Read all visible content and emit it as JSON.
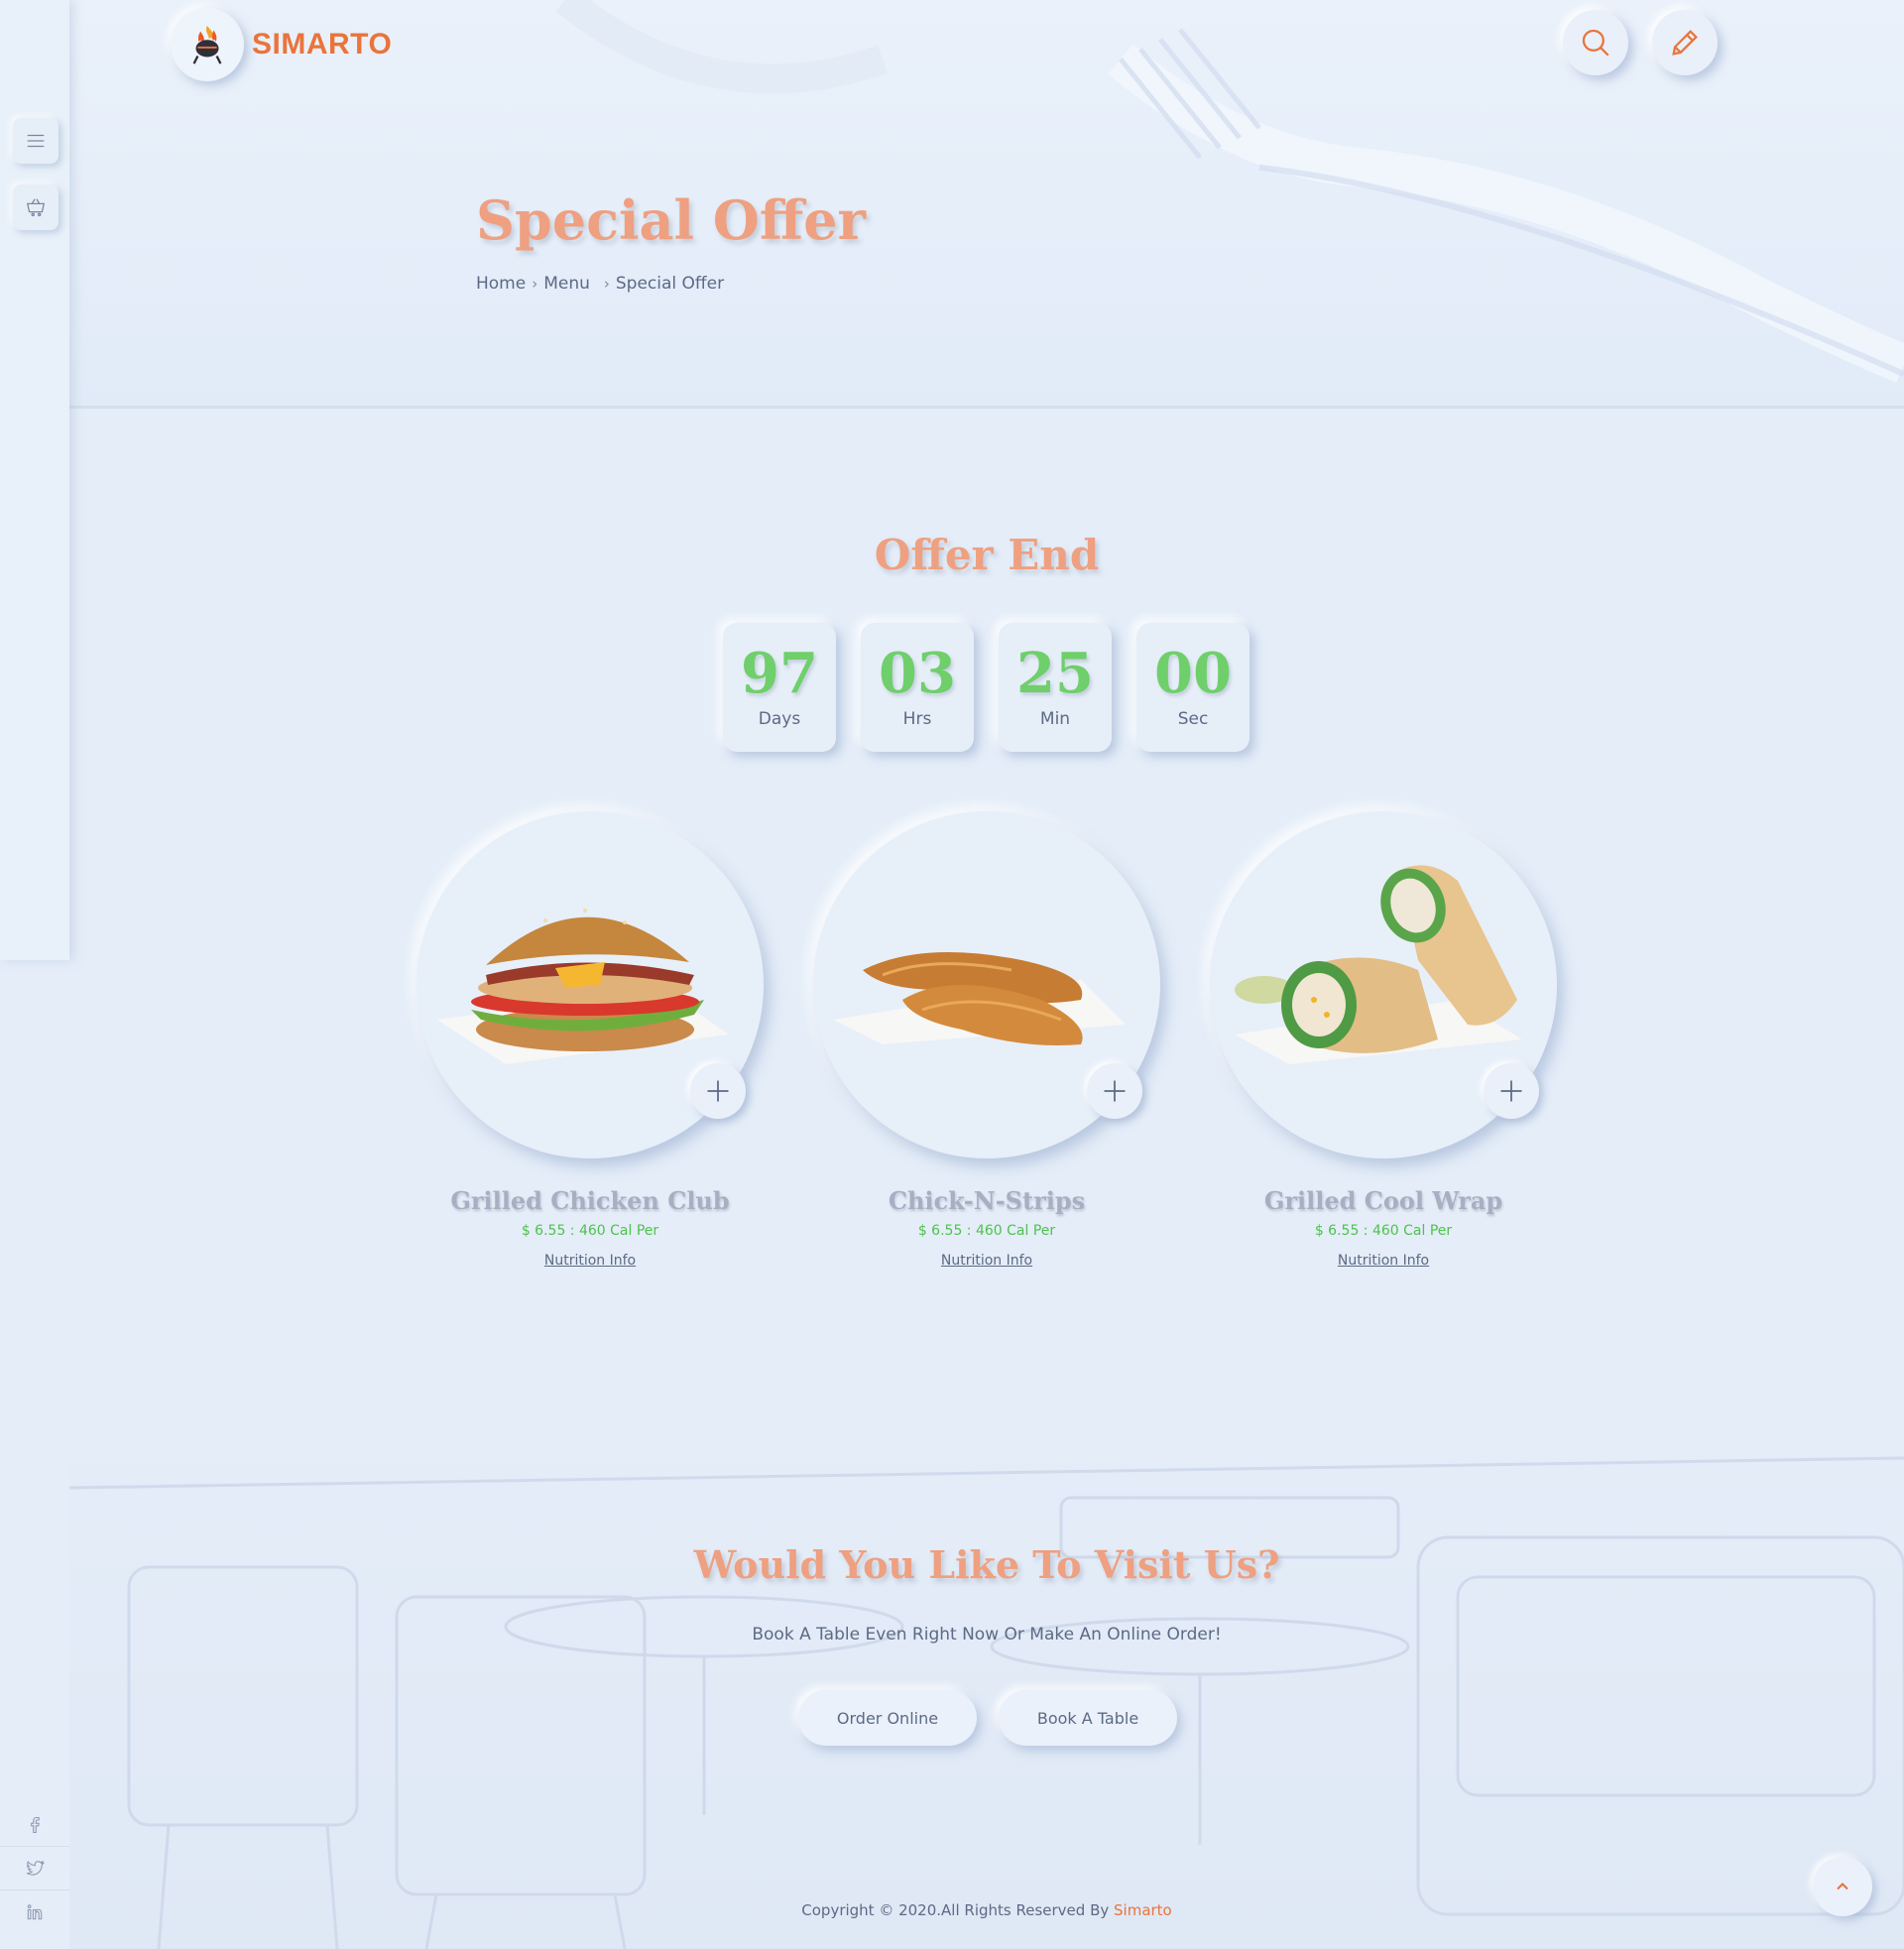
{
  "brand": {
    "name": "SIMARTO"
  },
  "hero": {
    "title": "Special Offer",
    "breadcrumb": [
      "Home",
      "Menu",
      "Special Offer"
    ]
  },
  "offer": {
    "title": "Offer End",
    "countdown": [
      {
        "value": "97",
        "label": "Days"
      },
      {
        "value": "03",
        "label": "Hrs"
      },
      {
        "value": "25",
        "label": "Min"
      },
      {
        "value": "00",
        "label": "Sec"
      }
    ]
  },
  "products": [
    {
      "name": "Grilled Chicken Club",
      "price": "$ 6.55 : 460 Cal Per",
      "info": "Nutrition Info"
    },
    {
      "name": "Chick-N-Strips",
      "price": "$ 6.55 : 460 Cal Per",
      "info": "Nutrition Info"
    },
    {
      "name": "Grilled Cool Wrap",
      "price": "$ 6.55 : 460 Cal Per",
      "info": "Nutrition Info"
    }
  ],
  "visit": {
    "title": "Would You Like To Visit Us?",
    "subtitle": "Book A Table Even Right Now Or Make An Online Order!",
    "order_label": "Order Online",
    "book_label": "Book A Table"
  },
  "footer": {
    "copyright": "Copyright © 2020.All Rights Reserved By ",
    "brand": "Simarto"
  },
  "colors": {
    "accent": "#e9743c",
    "title": "#eea081",
    "countdown": "#6fcf6b",
    "price": "#4fc24d",
    "background": "#e4edf8"
  },
  "icons": {
    "menu": "menu-icon",
    "cart": "cart-icon",
    "search": "search-icon",
    "edit": "pencil-icon",
    "add": "plus-icon",
    "social": [
      "facebook-icon",
      "twitter-icon",
      "linkedin-icon"
    ],
    "scroll_top": "chevron-up-icon"
  }
}
